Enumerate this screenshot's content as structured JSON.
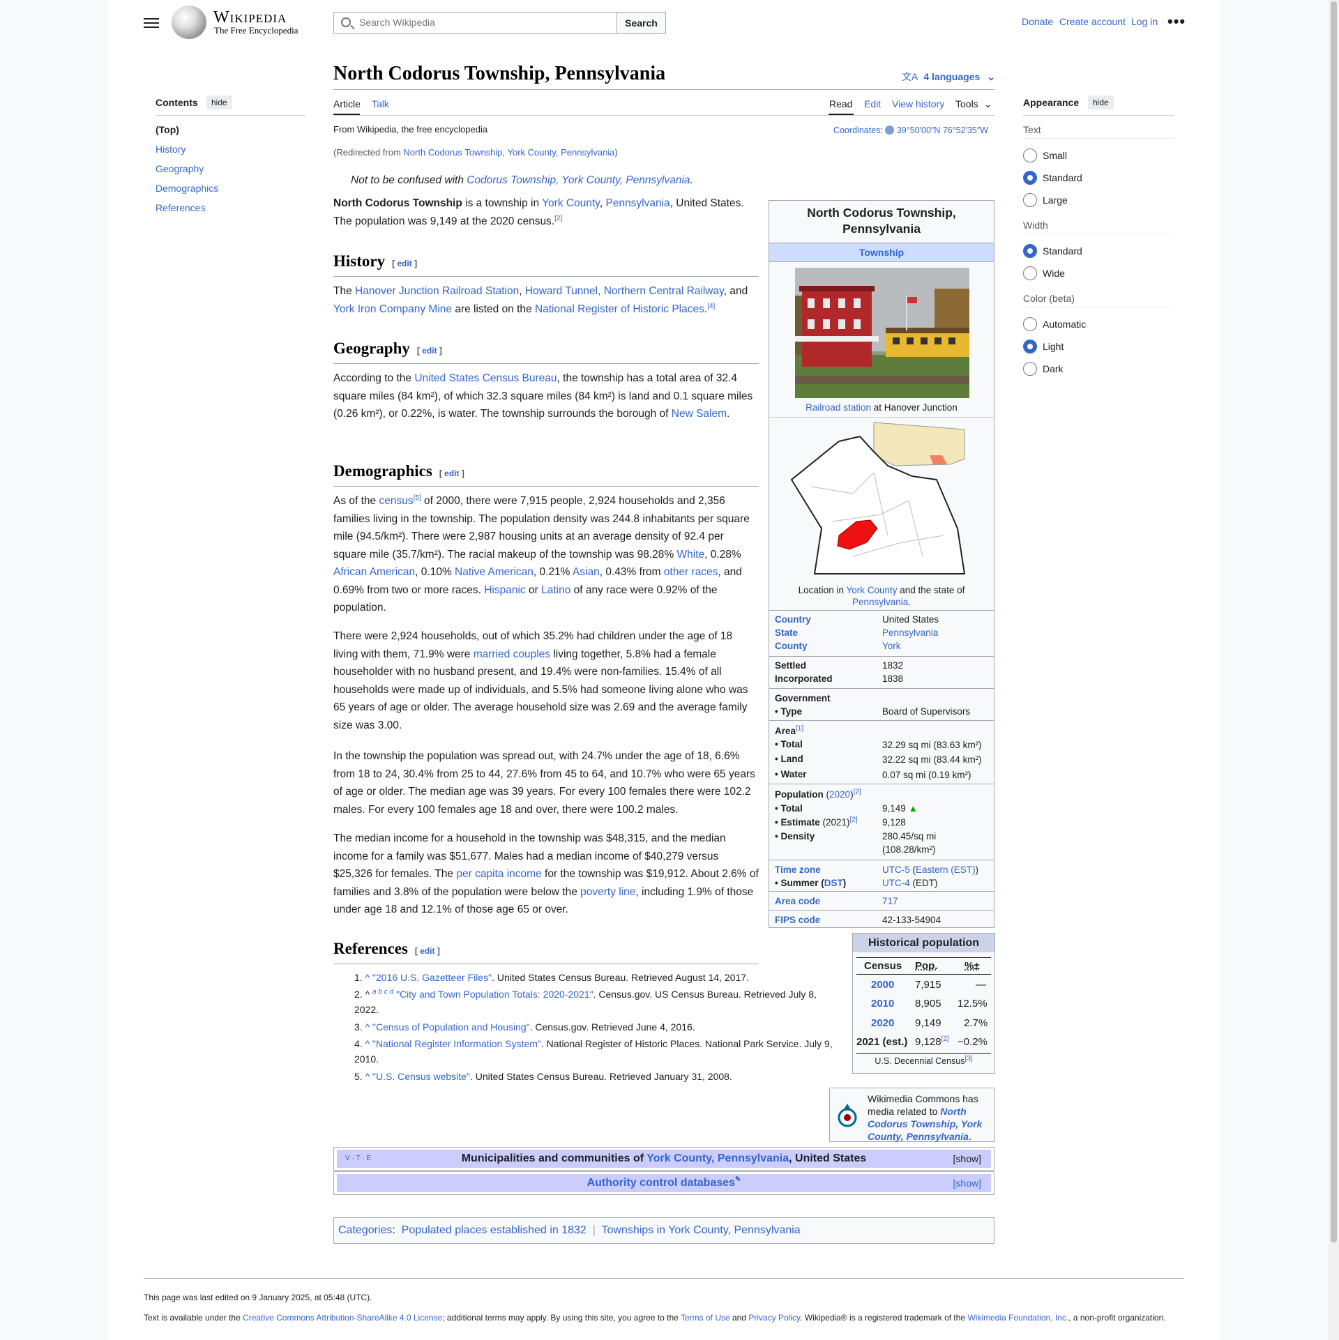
{
  "header": {
    "logo_title": "Wikipedia",
    "logo_tagline": "The Free Encyclopedia",
    "search_placeholder": "Search Wikipedia",
    "search_button": "Search",
    "donate": "Donate",
    "create_account": "Create account",
    "log_in": "Log in",
    "more": "•••"
  },
  "toc": {
    "title": "Contents",
    "hide": "hide",
    "items": [
      "(Top)",
      "History",
      "Geography",
      "Demographics",
      "References"
    ]
  },
  "article": {
    "title": "North Codorus Township, Pennsylvania",
    "languages": "4 languages",
    "tabs": {
      "article": "Article",
      "talk": "Talk",
      "read": "Read",
      "edit": "Edit",
      "history": "View history",
      "tools": "Tools"
    },
    "from": "From Wikipedia, the free encyclopedia",
    "redirect_pre": "(Redirected from ",
    "redirect_link": "North Codorus Township, York County, Pennsylvania",
    "redirect_post": ")",
    "coords_label": "Coordinates",
    "coords": "39°50′00″N 76°52′35″W",
    "hatnote_pre": "Not to be confused with ",
    "hatnote_link": "Codorus Township, York County, Pennsylvania",
    "hatnote_post": "."
  },
  "sections": {
    "history": "History",
    "geography": "Geography",
    "demographics": "Demographics",
    "references": "References",
    "edit": "edit"
  },
  "infobox": {
    "title": "North Codorus Township, Pennsylvania",
    "subtitle": "Township",
    "photo_caption_link": "Railroad station",
    "photo_caption": " at Hanover Junction",
    "map_caption_pre": "Location in ",
    "map_caption_link1": "York County",
    "map_caption_mid": " and the state of ",
    "map_caption_link2": "Pennsylvania",
    "map_caption_post": ".",
    "country_label": "Country",
    "country": "United States",
    "state_label": "State",
    "state": "Pennsylvania",
    "county_label": "County",
    "county": "York",
    "settled_label": "Settled",
    "settled": "1832",
    "incorporated_label": "Incorporated",
    "incorporated": "1838",
    "government_label": "Government",
    "type_label": "• Type",
    "type": "Board of Supervisors",
    "area_label": "Area",
    "area_total_label": "• Total",
    "area_total": "32.29 sq mi (83.63 km²)",
    "area_land_label": "• Land",
    "area_land": "32.22 sq mi (83.44 km²)",
    "area_water_label": "• Water",
    "area_water": "0.07 sq mi (0.19 km²)",
    "population_label": "Population",
    "population_year": "2020",
    "pop_total_label": "• Total",
    "pop_total": "9,149",
    "pop_est_label": "• Estimate",
    "pop_est_year": "(2021)",
    "pop_est": "9,128",
    "density_label": "• Density",
    "density": "280.45/sq mi",
    "density2": "(108.28/km²)",
    "timezone_label": "Time zone",
    "timezone_utc": "UTC-5",
    "timezone_name": "Eastern (EST)",
    "summer_label": "• Summer",
    "summer_dst": "DST",
    "summer_utc": "UTC-4",
    "summer_name": "(EDT)",
    "areacode_label": "Area code",
    "areacode": "717",
    "fips_label": "FIPS code",
    "fips": "42-133-54904"
  },
  "histpop": {
    "title": "Historical population",
    "h_census": "Census",
    "h_pop": "Pop.",
    "h_pct": "%±",
    "rows": [
      [
        "2000",
        "7,915",
        "—"
      ],
      [
        "2010",
        "8,905",
        "12.5%"
      ],
      [
        "2020",
        "9,149",
        "2.7%"
      ],
      [
        "2021 (est.)",
        "9,128",
        "−0.2%"
      ]
    ],
    "note": "U.S. Decennial Census"
  },
  "text": {
    "intro_b": "North Codorus Township",
    "intro1": " is a township in ",
    "intro_l1": "York County",
    "intro2": ", ",
    "intro_l2": "Pennsylvania",
    "intro3": ", United States. The population was 9,149 at the 2020 census.",
    "hist_1": "The ",
    "hist_l1": "Hanover Junction Railroad Station",
    "hist_2": ", ",
    "hist_l2": "Howard Tunnel, Northern Central Railway",
    "hist_3": ", and ",
    "hist_l3": "York Iron Company Mine",
    "hist_4": " are listed on the ",
    "hist_l4": "National Register of Historic Places",
    "hist_5": ".",
    "geo_1": "According to the ",
    "geo_l1": "United States Census Bureau",
    "geo_2": ", the township has a total area of 32.4 square miles (84 km²), of which 32.3 square miles (84 km²) is land and 0.1 square miles (0.26 km²), or 0.22%, is water. The township surrounds the borough of ",
    "geo_l2": "New Salem",
    "geo_3": ".",
    "dem1_1": "As of the ",
    "dem1_l1": "census",
    "dem1_2": " of 2000, there were 7,915 people, 2,924 households and 2,356 families living in the township. The population density was 244.8 inhabitants per square mile (94.5/km²). There were 2,987 housing units at an average density of 92.4 per square mile (35.7/km²). The racial makeup of the township was 98.28% ",
    "dem1_l2": "White",
    "dem1_3": ", 0.28% ",
    "dem1_l3": "African American",
    "dem1_4": ", 0.10% ",
    "dem1_l4": "Native American",
    "dem1_5": ", 0.21% ",
    "dem1_l5": "Asian",
    "dem1_6": ", 0.43% from ",
    "dem1_l6": "other races",
    "dem1_7": ", and 0.69% from two or more races. ",
    "dem1_l7": "Hispanic",
    "dem1_8": " or ",
    "dem1_l8": "Latino",
    "dem1_9": " of any race were 0.92% of the population.",
    "dem2_1": "There were 2,924 households, out of which 35.2% had children under the age of 18 living with them, 71.9% were ",
    "dem2_l1": "married couples",
    "dem2_2": " living together, 5.8% had a female householder with no husband present, and 19.4% were non-families. 15.4% of all households were made up of individuals, and 5.5% had someone living alone who was 65 years of age or older. The average household size was 2.69 and the average family size was 3.00.",
    "dem3": "In the township the population was spread out, with 24.7% under the age of 18, 6.6% from 18 to 24, 30.4% from 25 to 44, 27.6% from 45 to 64, and 10.7% who were 65 years of age or older. The median age was 39 years. For every 100 females there were 102.2 males. For every 100 females age 18 and over, there were 100.2 males.",
    "dem4_1": "The median income for a household in the township was $48,315, and the median income for a family was $51,677. Males had a median income of $40,279 versus $25,326 for females. The ",
    "dem4_l1": "per capita income",
    "dem4_2": " for the township was $19,912. About 2.6% of families and 3.8% of the population were below the ",
    "dem4_l2": "poverty line",
    "dem4_3": ", including 1.9% of those under age 18 and 12.1% of those age 65 or over."
  },
  "refs": [
    {
      "n": "1.",
      "link": "\"2016 U.S. Gazetteer Files\"",
      "rest": ". United States Census Bureau. Retrieved August 14, 2017."
    },
    {
      "n": "2.",
      "link": "\"City and Town Population Totals: 2020-2021\"",
      "rest": ". Census.gov. US Census Bureau. Retrieved July 8, 2022."
    },
    {
      "n": "3.",
      "link": "\"Census of Population and Housing\"",
      "rest": ". Census.gov. Retrieved June 4, 2016."
    },
    {
      "n": "4.",
      "link": "\"National Register Information System\"",
      "rest": ". National Register of Historic Places. National Park Service. July 9, 2010."
    },
    {
      "n": "5.",
      "link": "\"U.S. Census website\"",
      "rest": ". United States Census Bureau. Retrieved January 31, 2008."
    }
  ],
  "commons": {
    "text": "Wikimedia Commons has media related to ",
    "link": "North Codorus Township, York County, Pennsylvania",
    "post": "."
  },
  "navbox": {
    "vte": "V · T · E",
    "title_pre": "Municipalities and communities of ",
    "title_link": "York County, Pennsylvania",
    "title_post": ", United States",
    "show": "[show]",
    "authority": "Authority control databases"
  },
  "categories": {
    "label": "Categories",
    "c1": "Populated places established in 1832",
    "c2": "Townships in York County, Pennsylvania"
  },
  "footer": {
    "edited": "This page was last edited on 9 January 2025, at 05:48 (UTC).",
    "license_pre": "Text is available under the ",
    "license_link": "Creative Commons Attribution-ShareAlike 4.0 License",
    "license_mid": "; additional terms may apply. By using this site, you agree to the ",
    "terms": "Terms of Use",
    "and": " and ",
    "privacy": "Privacy Policy",
    "license_post": ". Wikipedia® is a registered trademark of the ",
    "wmf": "Wikimedia Foundation, Inc.",
    "nonprofit": ", a non-profit organization."
  },
  "appearance": {
    "title": "Appearance",
    "hide": "hide",
    "text_label": "Text",
    "text_opts": [
      "Small",
      "Standard",
      "Large"
    ],
    "width_label": "Width",
    "width_opts": [
      "Standard",
      "Wide"
    ],
    "color_label": "Color (beta)",
    "color_opts": [
      "Automatic",
      "Light",
      "Dark"
    ]
  },
  "colors": {
    "link": "#3366cc",
    "accent": "#3366cc",
    "infobox_header": "#ccddff",
    "navbox_header": "#ccccff"
  }
}
